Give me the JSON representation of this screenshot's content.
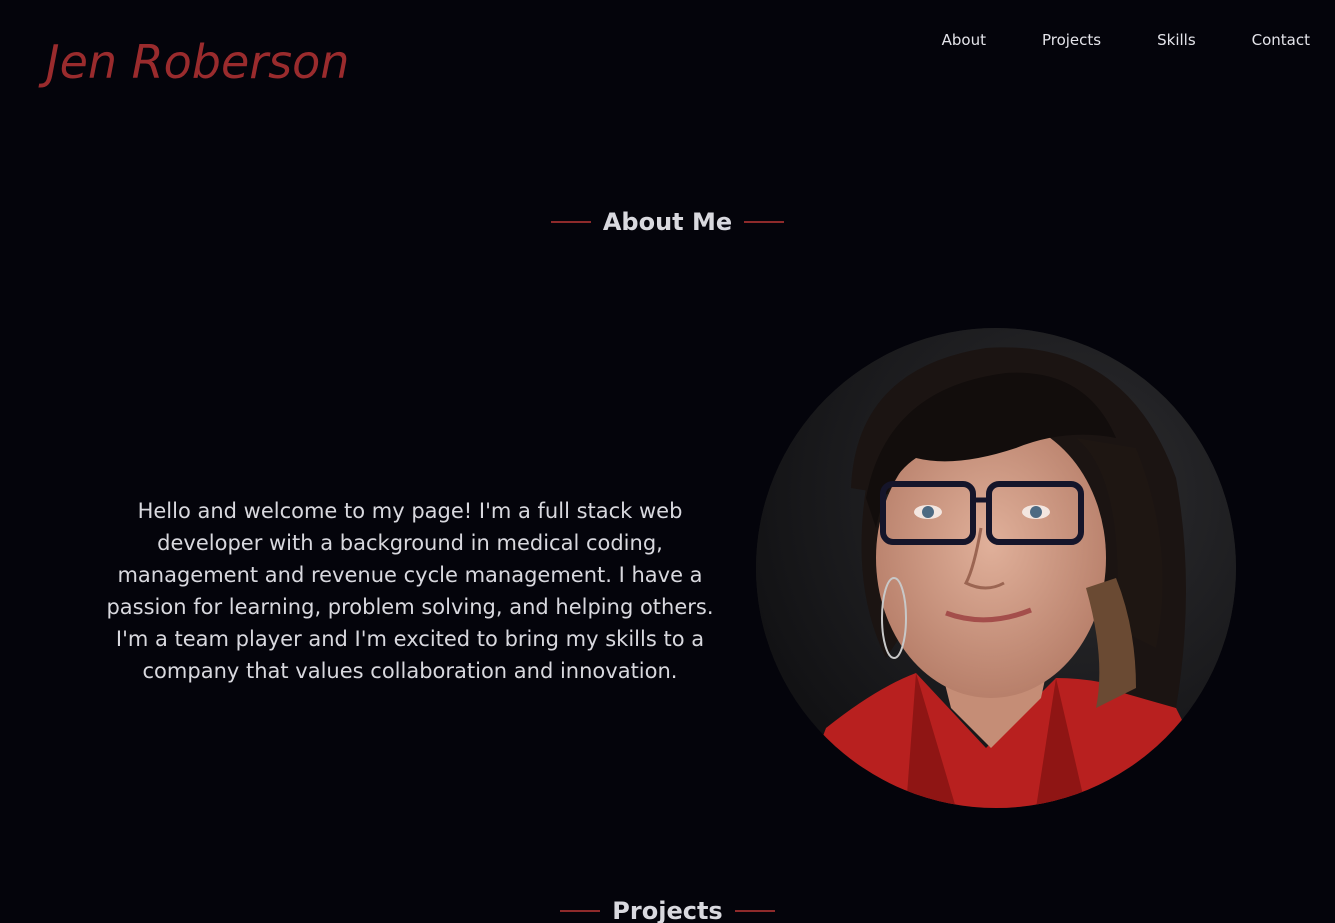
{
  "header": {
    "brand": "Jen Roberson",
    "nav": [
      "About",
      "Projects",
      "Skills",
      "Contact"
    ]
  },
  "about": {
    "heading": "About Me",
    "paragraph": "Hello and welcome to my page! I'm a full stack web developer with a background in medical coding, management and revenue cycle management. I have a passion for learning, problem solving, and helping others. I'm a team player and I'm excited to bring my skills to a company that values collaboration and innovation.",
    "portrait_alt": "portrait photo"
  },
  "projects": {
    "heading": "Projects"
  },
  "colors": {
    "background": "#04040b",
    "accent": "#9a2b2d",
    "text": "#d8d8de"
  }
}
